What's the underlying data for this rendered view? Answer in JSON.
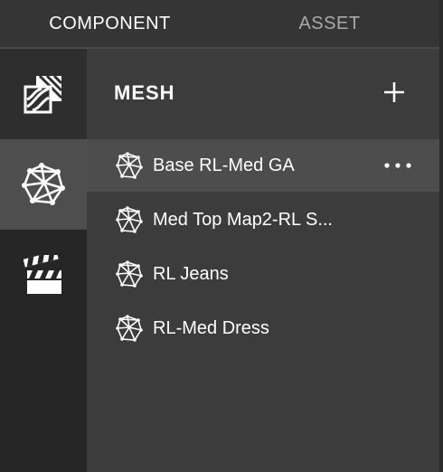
{
  "tabs": [
    {
      "label": "COMPONENT",
      "active": true
    },
    {
      "label": "ASSET",
      "active": false
    }
  ],
  "sidebar": {
    "buttons": [
      {
        "icon": "texture-icon",
        "selected": false
      },
      {
        "icon": "mesh-icon",
        "selected": true
      },
      {
        "icon": "clapperboard-icon",
        "selected": false
      }
    ]
  },
  "panel": {
    "title": "MESH",
    "add_icon": "plus-icon",
    "items": [
      {
        "label": "Base RL-Med GA",
        "selected": true
      },
      {
        "label": "Med Top Map2-RL S...",
        "selected": false
      },
      {
        "label": "RL Jeans",
        "selected": false
      },
      {
        "label": "RL-Med Dress",
        "selected": false
      }
    ]
  },
  "colors": {
    "background": "#3c3c3c",
    "sidebar": "#262626",
    "selected_sidebar": "#4e4e4e",
    "selected_item": "#4d4d4d",
    "inactive_tab_text": "#a9a9a9"
  }
}
